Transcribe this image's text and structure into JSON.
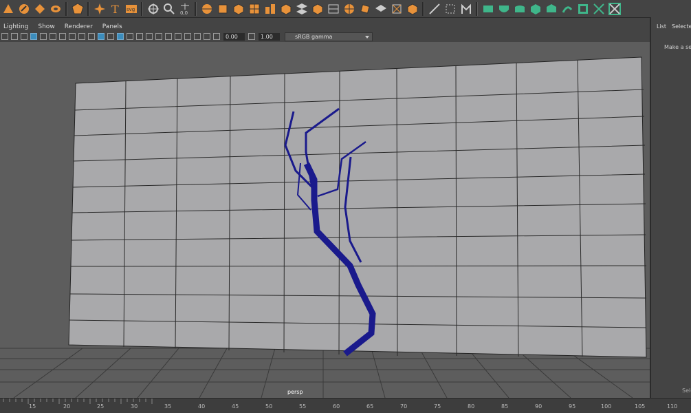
{
  "menus": [
    "Lighting",
    "Show",
    "Renderer",
    "Panels"
  ],
  "viewport_toolbar": {
    "exposure": "0.00",
    "gamma": "1.00",
    "colorspace": "sRGB gamma"
  },
  "camera_label": "persp",
  "outliner": {
    "tab_list": "List",
    "tab_selected": "Selected",
    "hint": "Make a sele",
    "footer": "Sele"
  },
  "timeline": {
    "ticks": [
      "15",
      "20",
      "25",
      "30",
      "35",
      "40",
      "45",
      "50",
      "55",
      "60",
      "65",
      "70",
      "75",
      "80",
      "85",
      "90",
      "95",
      "100",
      "105",
      "110"
    ]
  },
  "colors": {
    "ui_bg": "#444444",
    "viewport_bg": "#5d5d5d",
    "wall": "#a9a9ab",
    "grid_line": "#2a2a2a",
    "tree": "#1a1a8c",
    "shelf_icon": "#e8923a",
    "green_icon": "#3fb68a"
  }
}
